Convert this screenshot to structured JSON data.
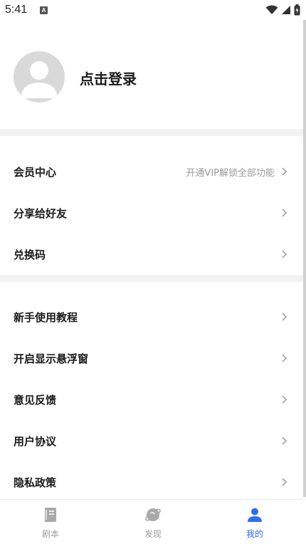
{
  "status_bar": {
    "time": "5:41",
    "notification_badge": "A",
    "icons": [
      "wifi-icon",
      "signal-icon",
      "battery-icon"
    ]
  },
  "profile": {
    "login_label": "点击登录"
  },
  "menu_group_1": [
    {
      "label": "会员中心",
      "hint": "开通VIP解锁全部功能"
    },
    {
      "label": "分享给好友",
      "hint": ""
    },
    {
      "label": "兑换码",
      "hint": ""
    }
  ],
  "menu_group_2": [
    {
      "label": "新手使用教程"
    },
    {
      "label": "开启显示悬浮窗"
    },
    {
      "label": "意见反馈"
    },
    {
      "label": "用户协议"
    },
    {
      "label": "隐私政策"
    }
  ],
  "bottom_nav": [
    {
      "label": "剧本",
      "icon": "script-book-icon",
      "active": false
    },
    {
      "label": "发现",
      "icon": "discover-planet-icon",
      "active": false
    },
    {
      "label": "我的",
      "icon": "profile-person-icon",
      "active": true
    }
  ],
  "colors": {
    "accent": "#2f6ef2",
    "inactive": "#9a9a9a",
    "divider": "#f2f2f2",
    "avatar_bg": "#d9d9d9"
  }
}
